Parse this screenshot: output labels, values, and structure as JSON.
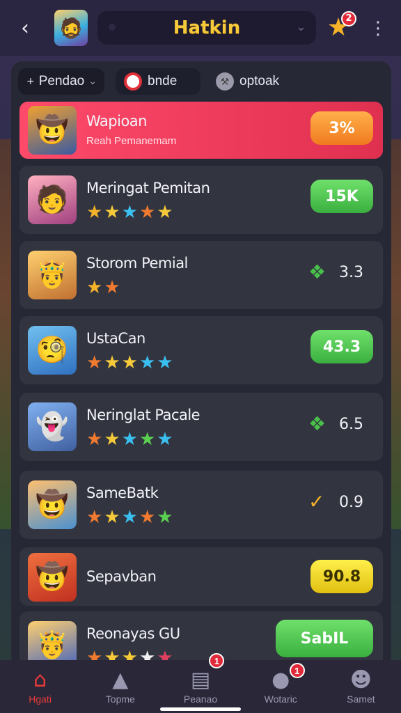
{
  "header": {
    "back_icon": "back-arrow-icon",
    "title": "Hatkin",
    "notif_badge": "2"
  },
  "filters": [
    {
      "label": "Pendao",
      "icon": "plus-icon"
    },
    {
      "label": "bnde",
      "icon": "target-icon"
    },
    {
      "label": "optoak",
      "icon": "wrench-icon"
    }
  ],
  "rows": [
    {
      "title": "Wapioan",
      "subtitle": "Reah Pemanemam",
      "score": "3%",
      "style": "highlight"
    },
    {
      "title": "Meringat Pemitan",
      "score": "15K",
      "stars": [
        "#f5b32a",
        "#f5c93a",
        "#3ac0f0",
        "#f07a30",
        "#f5c93a"
      ]
    },
    {
      "title": "Storom Pemial",
      "score": "3.3",
      "stars": [
        "#f5b32a",
        "#f07a30"
      ]
    },
    {
      "title": "UstaCan",
      "score": "43.3",
      "stars": [
        "#f07a30",
        "#f5c93a",
        "#f5c93a",
        "#3ac0f0",
        "#3ac0f0"
      ]
    },
    {
      "title": "Neringlat Pacale",
      "score": "6.5",
      "stars": [
        "#f07a30",
        "#f5c93a",
        "#3ac0f0",
        "#5ad050",
        "#3ac0f0"
      ]
    },
    {
      "title": "SameBatk",
      "score": "0.9",
      "stars": [
        "#f07a30",
        "#f5c93a",
        "#3ac0f0",
        "#f07a30",
        "#5ad050"
      ]
    },
    {
      "title": "Sepavban",
      "score": "90.8"
    },
    {
      "title": "Reonayas GU",
      "score": "SabIL",
      "stars": [
        "#f07a30",
        "#f5c93a",
        "#f5c93a",
        "#f0f0f0",
        "#e04060"
      ]
    }
  ],
  "nav": [
    {
      "label": "Hgati",
      "icon": "home-icon"
    },
    {
      "label": "Topme",
      "icon": "bell-icon"
    },
    {
      "label": "Peanao",
      "icon": "inbox-icon",
      "badge": "1"
    },
    {
      "label": "Wotaric",
      "icon": "chat-icon",
      "badge": "1"
    },
    {
      "label": "Samet",
      "icon": "user-icon"
    }
  ],
  "colors": {
    "accent_red": "#e83a3a",
    "title_gold": "#f5c93a",
    "highlight_row": "#ff4a6a"
  }
}
